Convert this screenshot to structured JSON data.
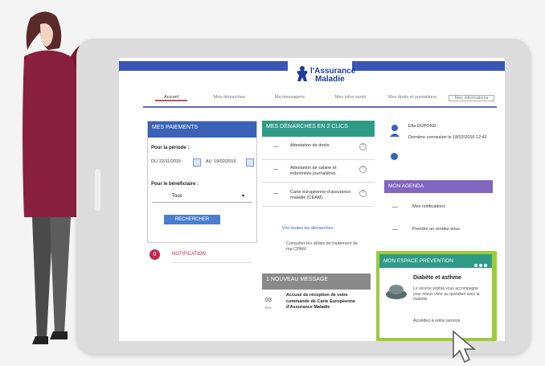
{
  "header": {
    "brand_line1": "l'Assurance",
    "brand_line2": "Maladie"
  },
  "tabs": [
    {
      "label": "Accueil"
    },
    {
      "label": "Mes démarches"
    },
    {
      "label": "Ma messagerie"
    },
    {
      "label": "Mes infos santé"
    },
    {
      "label": "Mes droits et prestations"
    },
    {
      "label": "Mes informations"
    }
  ],
  "paiements": {
    "title": "MES PAIEMENTS",
    "period_label": "Pour la période :",
    "from_prefix": "DU",
    "from_date": "22/11/2015",
    "to_prefix": "AU",
    "to_date": "19/02/2016",
    "beneficiary_label": "Pour le bénéficiaire :",
    "beneficiary_value": "Tous",
    "search_button": "RECHERCHER"
  },
  "notification": {
    "count": "0",
    "label": "NOTIFICATION"
  },
  "demarches": {
    "title": "MES DÉMARCHES EN 2 CLICS",
    "items": [
      {
        "label": "Attestation de droits"
      },
      {
        "label": "Attestation de salaire et indemnités journalières"
      },
      {
        "label": "Carte européenne d'assurance maladie (CEAM)"
      }
    ],
    "all_link": "Voir toutes les démarches",
    "delay_link": "Consulter les délais de traitement de ma CPAM"
  },
  "message": {
    "title": "1 NOUVEAU MESSAGE",
    "date_day": "03",
    "date_month": "févr.",
    "text": "Accusé de réception de votre commande de Carte Européenne d'Assurance Maladie"
  },
  "user": {
    "name": "Ella DUPOND",
    "last_login": "Dernière connexion le 18/02/2016 12:41"
  },
  "agenda": {
    "title": "MON AGENDA",
    "items": [
      {
        "label": "Mes notifications"
      },
      {
        "label": "Prendre un rendez-vous"
      }
    ]
  },
  "prevention": {
    "title": "MON ESPACE PRÉVENTION",
    "subject": "Diabète et asthme",
    "description": "Le service sophia vous accompagne pour mieux vivre au quotidien avec la maladie",
    "link": "Accédez à votre service",
    "accent": "#9ccc3c"
  },
  "colors": {
    "header_blue": "#3a56b4",
    "paiements": "#3a62b8",
    "demarches": "#2f9b86",
    "agenda": "#8266c0",
    "notification": "#c2264c"
  }
}
